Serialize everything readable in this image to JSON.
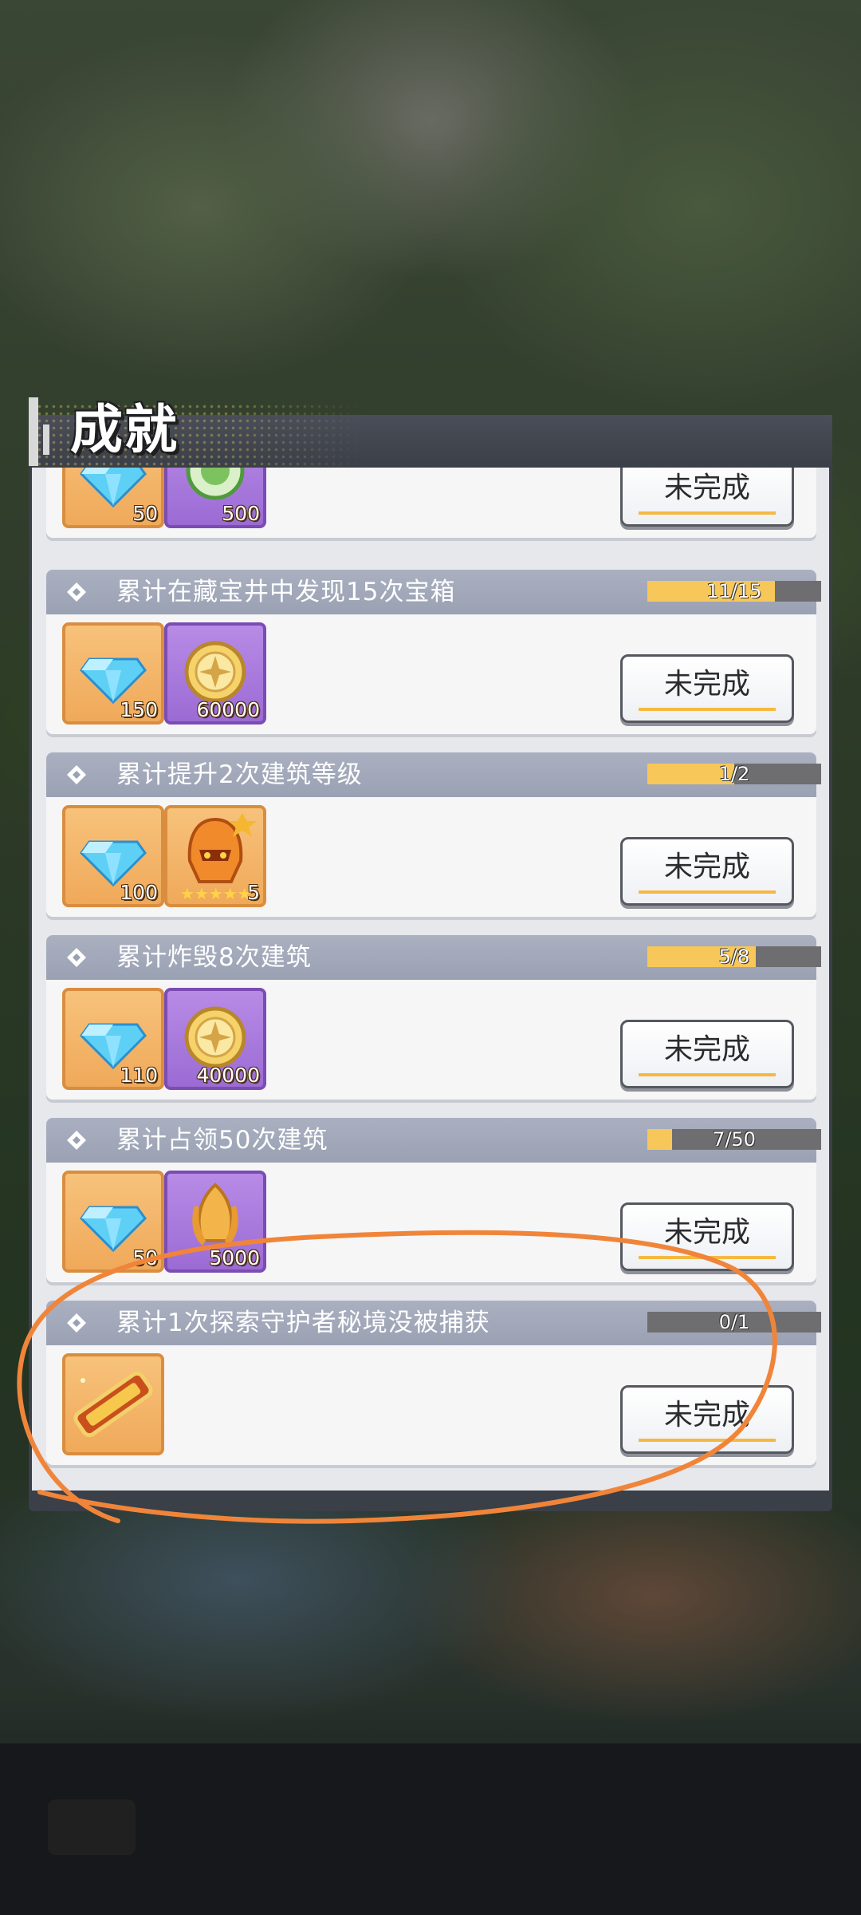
{
  "screen": {
    "title": "成就"
  },
  "colors": {
    "header_gray": "#3b3f48",
    "task_head": "#9aa1b3",
    "progress_fill": "#f7c75a",
    "progress_track": "#6e6e70",
    "annotation_orange": "#f0853a"
  },
  "tasks": [
    {
      "title": "",
      "rewards": [
        {
          "icon": "diamond-icon",
          "amount": "50",
          "frame": "orange"
        },
        {
          "icon": "green-token-icon",
          "amount": "500",
          "frame": "purple"
        }
      ],
      "progress_text": "",
      "progress_fraction": null,
      "status": "未完成"
    },
    {
      "title": "累计在藏宝井中发现15次宝箱",
      "rewards": [
        {
          "icon": "diamond-icon",
          "amount": "150",
          "frame": "orange"
        },
        {
          "icon": "gold-coin-icon",
          "amount": "60000",
          "frame": "purple"
        }
      ],
      "progress_text": "11/15",
      "progress_fraction": 0.733,
      "status": "未完成"
    },
    {
      "title": "累计提升2次建筑等级",
      "rewards": [
        {
          "icon": "diamond-icon",
          "amount": "100",
          "frame": "orange"
        },
        {
          "icon": "hero-helmet-icon",
          "amount": "5",
          "frame": "orange"
        }
      ],
      "progress_text": "1/2",
      "progress_fraction": 0.5,
      "status": "未完成"
    },
    {
      "title": "累计炸毁8次建筑",
      "rewards": [
        {
          "icon": "diamond-icon",
          "amount": "110",
          "frame": "orange"
        },
        {
          "icon": "gold-coin-icon",
          "amount": "40000",
          "frame": "purple"
        }
      ],
      "progress_text": "5/8",
      "progress_fraction": 0.625,
      "status": "未完成"
    },
    {
      "title": "累计占领50次建筑",
      "rewards": [
        {
          "icon": "diamond-icon",
          "amount": "50",
          "frame": "orange"
        },
        {
          "icon": "golden-flower-icon",
          "amount": "5000",
          "frame": "purple"
        }
      ],
      "progress_text": "7/50",
      "progress_fraction": 0.14,
      "status": "未完成"
    },
    {
      "title": "累计1次探索守护者秘境没被捕获",
      "rewards": [
        {
          "icon": "title-badge-icon",
          "amount": "",
          "frame": "orange"
        }
      ],
      "progress_text": "0/1",
      "progress_fraction": 0,
      "status": "未完成"
    }
  ]
}
